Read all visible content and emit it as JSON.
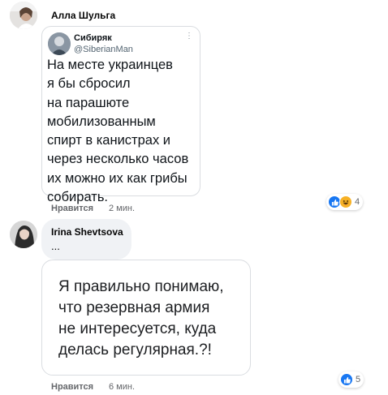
{
  "comments": [
    {
      "author": "Алла Шульга",
      "tweet": {
        "name": "Сибиряк",
        "handle": "@SiberianMan",
        "more": "⋮",
        "text": "На месте украинцев\nя бы сбросил\nна парашюте\nмобилизованным\nспирт в канистрах и\nчерез несколько часов\nих можно их как грибы\nсобирать."
      },
      "like_label": "Нравится",
      "time": "2 мин.",
      "reactions": {
        "icons": [
          "like-icon",
          "haha-icon"
        ],
        "count": "4"
      }
    },
    {
      "author": "Irina Shevtsova",
      "text": "...",
      "image_text": "Я правильно понимаю,\nчто резервная армия\nне интересуется, куда\nделась регулярная.?!",
      "like_label": "Нравится",
      "time": "6 мин.",
      "reactions": {
        "icons": [
          "like-icon"
        ],
        "count": "5"
      }
    }
  ],
  "colors": {
    "like_blue": "#1877f2",
    "haha_yellow": "#f7b125",
    "bubble_bg": "#f0f2f5",
    "muted_text": "#65676b"
  }
}
